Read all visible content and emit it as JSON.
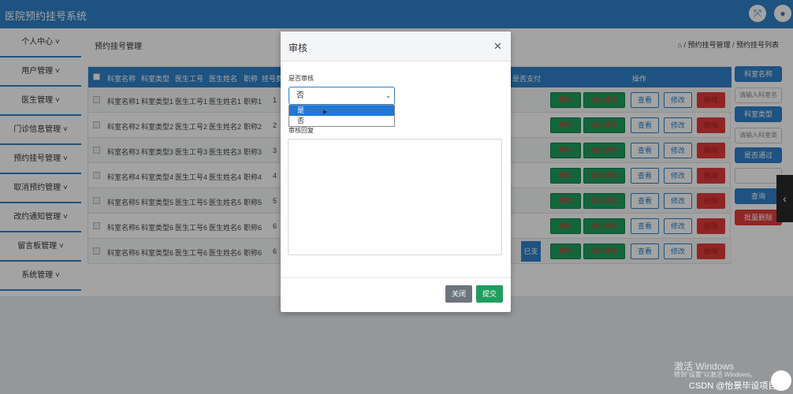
{
  "header": {
    "app_title": "医院预约挂号系统",
    "fullscreen_icon": "expand-icon",
    "user_icon": "user-icon"
  },
  "sidebar": {
    "items": [
      {
        "label": "个人中心"
      },
      {
        "label": "用户管理"
      },
      {
        "label": "医生管理"
      },
      {
        "label": "门诊信息管理"
      },
      {
        "label": "预约挂号管理"
      },
      {
        "label": "取消预约管理"
      },
      {
        "label": "改约通知管理"
      },
      {
        "label": "留言板管理"
      },
      {
        "label": "系统管理"
      }
    ]
  },
  "main": {
    "page_title": "预约挂号管理",
    "breadcrumb": "⌂ / 预约挂号管理 / 预约挂号列表"
  },
  "table": {
    "columns": [
      "科室名称",
      "科室类型",
      "医生工号",
      "医生姓名",
      "职称",
      "挂号费",
      "是否支付",
      "操作"
    ],
    "rows": [
      {
        "dept": "科室名称1",
        "type": "科室类型1",
        "doc_id": "医生工号1",
        "doc_name": "医生姓名1",
        "title": "职称1",
        "fee": "1"
      },
      {
        "dept": "科室名称2",
        "type": "科室类型2",
        "doc_id": "医生工号2",
        "doc_name": "医生姓名2",
        "title": "职称2",
        "fee": "2"
      },
      {
        "dept": "科室名称3",
        "type": "科室类型3",
        "doc_id": "医生工号3",
        "doc_name": "医生姓名3",
        "title": "职称3",
        "fee": "3"
      },
      {
        "dept": "科室名称4",
        "type": "科室类型4",
        "doc_id": "医生工号4",
        "doc_name": "医生姓名4",
        "title": "职称4",
        "fee": "4"
      },
      {
        "dept": "科室名称5",
        "type": "科室类型5",
        "doc_id": "医生工号5",
        "doc_name": "医生姓名5",
        "title": "职称5",
        "fee": "5"
      },
      {
        "dept": "科室名称6",
        "type": "科室类型6",
        "doc_id": "医生工号6",
        "doc_name": "医生姓名6",
        "title": "职称6",
        "fee": "6"
      },
      {
        "dept": "科室名称6",
        "type": "科室类型6",
        "doc_id": "医生工号6",
        "doc_name": "医生姓名6",
        "title": "职称6",
        "fee": "6",
        "paid": "已支付"
      }
    ],
    "actions": {
      "review": "审核",
      "notify": "改约通知",
      "view": "查看",
      "edit": "修改",
      "delete": "删除"
    }
  },
  "filters": {
    "dept_label": "科室名称",
    "dept_placeholder": "请输入科室名",
    "type_label": "科室类型",
    "type_placeholder": "请输入科室类",
    "passed_label": "是否通过",
    "query_label": "查询",
    "batch_delete_label": "批量删除"
  },
  "modal": {
    "title": "审核",
    "review_label": "是否审核",
    "select_value": "否",
    "options": [
      "是",
      "否"
    ],
    "reply_label": "审核回复",
    "close_label": "关闭",
    "submit_label": "提交"
  },
  "watermark": {
    "line1": "激活 Windows",
    "line2": "转到\"设置\"以激活 Windows。",
    "csdn": "CSDN @怡景毕设项目"
  }
}
